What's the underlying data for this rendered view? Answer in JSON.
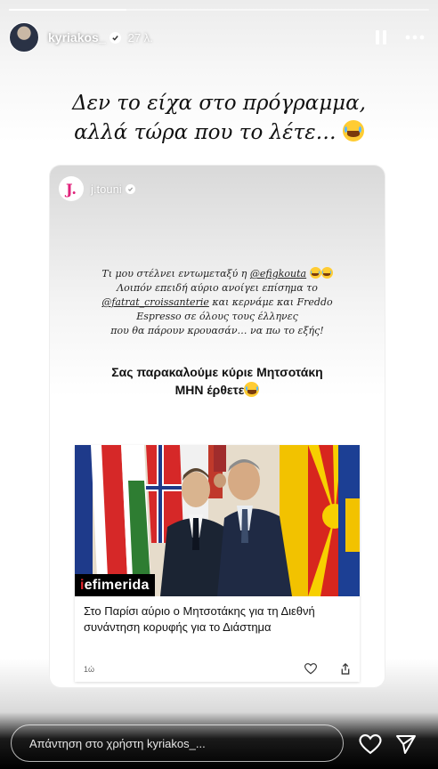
{
  "header": {
    "username": "kyriakos_",
    "time": "27 λ.",
    "progress": 0.28
  },
  "caption": {
    "line1": "Δεν το είχα στο πρόγραμμα,",
    "line2": "αλλά τώρα που το λέτε…"
  },
  "shared_post": {
    "author_initial": "J.",
    "author": "j.touni",
    "text_part1": "Τι μου στέλνει εντωμεταξύ η ",
    "mention1": "@efigkouta",
    "text_part2": "Λοιπόν επειδή αύριο ανοίγει επίσημα το",
    "mention2": "@fatrat_croissanterie",
    "text_part3": " και κερνάμε και Freddo",
    "text_part4": "Espresso σε όλους τους έλληνες",
    "text_part5": "που θα πάρουν κρουασάν… να πω το εξής!",
    "bold_line1": "Σας παρακαλούμε κύριε Μητσοτάκη",
    "bold_line2": "ΜΗΝ έρθετε"
  },
  "news": {
    "logo_i": "i",
    "logo_rest": "efimerida",
    "headline": "Στο Παρίσι αύριο ο Μητσοτάκης για τη Διεθνή συνάντηση κορυφής για το Διάστημα",
    "ago": "1ώ"
  },
  "reply": {
    "placeholder": "Απάντηση στο χρήστη kyriakos_..."
  },
  "icons": {
    "pause": "pause-icon",
    "more": "more-icon",
    "heart": "heart-icon",
    "send": "send-icon"
  }
}
